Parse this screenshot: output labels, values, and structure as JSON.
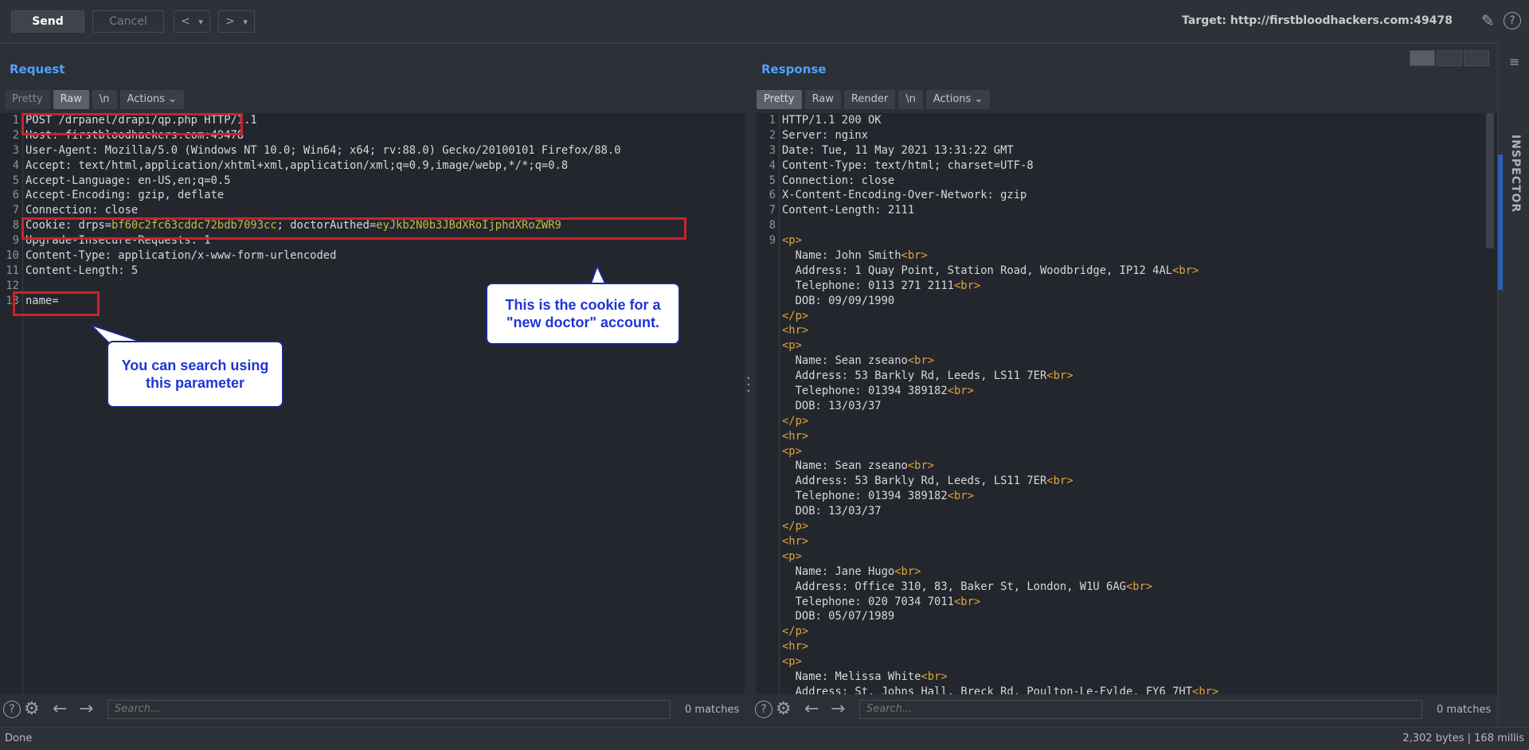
{
  "toolbar": {
    "send_label": "Send",
    "cancel_label": "Cancel",
    "back_arrow": "<",
    "forward_arrow": ">",
    "dropdown_glyph": "▾",
    "target": "Target: http://firstbloodhackers.com:49478"
  },
  "request": {
    "title": "Request",
    "tabs": [
      {
        "label": "Pretty"
      },
      {
        "label": "Raw"
      },
      {
        "label": "\\n"
      },
      {
        "label": "Actions"
      }
    ],
    "lines": [
      {
        "n": "1",
        "text": "POST /drpanel/drapi/qp.php HTTP/1.1"
      },
      {
        "n": "2",
        "text": "Host: firstbloodhackers.com:49478"
      },
      {
        "n": "3",
        "text": "User-Agent: Mozilla/5.0 (Windows NT 10.0; Win64; x64; rv:88.0) Gecko/20100101 Firefox/88.0"
      },
      {
        "n": "4",
        "text": "Accept: text/html,application/xhtml+xml,application/xml;q=0.9,image/webp,*/*;q=0.8"
      },
      {
        "n": "5",
        "text": "Accept-Language: en-US,en;q=0.5"
      },
      {
        "n": "6",
        "text": "Accept-Encoding: gzip, deflate"
      },
      {
        "n": "7",
        "text": "Connection: close"
      },
      {
        "n": "8",
        "text": "Cookie: drps=",
        "cookie_drps": "bf60c2fc63cddc72bdb7093cc",
        "sep": "; doctorAuthed=",
        "cookie_auth": "eyJkb2N0b3JBdXRoIjphdXRoZWR9"
      },
      {
        "n": "9",
        "text": "Upgrade-Insecure-Requests: 1"
      },
      {
        "n": "10",
        "text": "Content-Type: application/x-www-form-urlencoded"
      },
      {
        "n": "11",
        "text": "Content-Length: 5"
      },
      {
        "n": "12",
        "text": ""
      },
      {
        "n": "13",
        "text": "name="
      }
    ],
    "search_placeholder": "Search...",
    "matches": "0 matches"
  },
  "response": {
    "title": "Response",
    "tabs": [
      {
        "label": "Pretty"
      },
      {
        "label": "Raw"
      },
      {
        "label": "Render"
      },
      {
        "label": "\\n"
      },
      {
        "label": "Actions"
      }
    ],
    "headers": [
      {
        "n": "1",
        "text": "HTTP/1.1 200 OK"
      },
      {
        "n": "2",
        "text": "Server: nginx"
      },
      {
        "n": "3",
        "text": "Date: Tue, 11 May 2021 13:31:22 GMT"
      },
      {
        "n": "4",
        "text": "Content-Type: text/html; charset=UTF-8"
      },
      {
        "n": "5",
        "text": "Connection: close"
      },
      {
        "n": "6",
        "text": "X-Content-Encoding-Over-Network: gzip"
      },
      {
        "n": "7",
        "text": "Content-Length: 2111"
      },
      {
        "n": "8",
        "text": ""
      },
      {
        "n": "9",
        "text": ""
      }
    ],
    "body_lines": [
      {
        "indent": "",
        "text": "",
        "tag": "<p>"
      },
      {
        "indent": "  ",
        "text": "Name: John Smith",
        "tag": "<br>"
      },
      {
        "indent": "  ",
        "text": "Address: 1 Quay Point, Station Road, Woodbridge, IP12 4AL",
        "tag": "<br>"
      },
      {
        "indent": "  ",
        "text": "Telephone: 0113 271 2111",
        "tag": "<br>"
      },
      {
        "indent": "  ",
        "text": "DOB: 09/09/1990",
        "tag": ""
      },
      {
        "indent": "",
        "text": "",
        "tag": "</p>"
      },
      {
        "indent": "",
        "text": "",
        "tag": "<hr>"
      },
      {
        "indent": "",
        "text": "",
        "tag": "<p>"
      },
      {
        "indent": "  ",
        "text": "Name: Sean zseano",
        "tag": "<br>"
      },
      {
        "indent": "  ",
        "text": "Address: 53 Barkly Rd, Leeds, LS11 7ER",
        "tag": "<br>"
      },
      {
        "indent": "  ",
        "text": "Telephone: 01394 389182",
        "tag": "<br>"
      },
      {
        "indent": "  ",
        "text": "DOB: 13/03/37",
        "tag": ""
      },
      {
        "indent": "",
        "text": "",
        "tag": "</p>"
      },
      {
        "indent": "",
        "text": "",
        "tag": "<hr>"
      },
      {
        "indent": "",
        "text": "",
        "tag": "<p>"
      },
      {
        "indent": "  ",
        "text": "Name: Sean zseano",
        "tag": "<br>"
      },
      {
        "indent": "  ",
        "text": "Address: 53 Barkly Rd, Leeds, LS11 7ER",
        "tag": "<br>"
      },
      {
        "indent": "  ",
        "text": "Telephone: 01394 389182",
        "tag": "<br>"
      },
      {
        "indent": "  ",
        "text": "DOB: 13/03/37",
        "tag": ""
      },
      {
        "indent": "",
        "text": "",
        "tag": "</p>"
      },
      {
        "indent": "",
        "text": "",
        "tag": "<hr>"
      },
      {
        "indent": "",
        "text": "",
        "tag": "<p>"
      },
      {
        "indent": "  ",
        "text": "Name: Jane Hugo",
        "tag": "<br>"
      },
      {
        "indent": "  ",
        "text": "Address: Office 310, 83, Baker St, London, W1U 6AG",
        "tag": "<br>"
      },
      {
        "indent": "  ",
        "text": "Telephone: 020 7034 7011",
        "tag": "<br>"
      },
      {
        "indent": "  ",
        "text": "DOB: 05/07/1989",
        "tag": ""
      },
      {
        "indent": "",
        "text": "",
        "tag": "</p>"
      },
      {
        "indent": "",
        "text": "",
        "tag": "<hr>"
      },
      {
        "indent": "",
        "text": "",
        "tag": "<p>"
      },
      {
        "indent": "  ",
        "text": "Name: Melissa White",
        "tag": "<br>"
      },
      {
        "indent": "  ",
        "text": "Address: St. Johns Hall, Breck Rd, Poulton-Le-Fylde, FY6 7HT",
        "tag": "<br>"
      }
    ],
    "search_placeholder": "Search...",
    "matches": "0 matches"
  },
  "annotations": {
    "cookie_note": "This is the cookie for a \"new doctor\" account.",
    "param_note": "You can search using this parameter"
  },
  "status": {
    "left": "Done",
    "right": "2,302 bytes | 168 millis"
  },
  "inspector": {
    "label": "INSPECTOR"
  },
  "colors": {
    "accent_blue": "#4da3ff",
    "annotation_red": "#c8232c",
    "callout_text": "#1f35d6",
    "value_yellow": "#c7b74b",
    "tag_orange": "#e1a43d"
  },
  "icons": [
    "edit-icon",
    "help-icon",
    "settings-icon",
    "arrow-left-icon",
    "arrow-right-icon",
    "layout-icon"
  ]
}
